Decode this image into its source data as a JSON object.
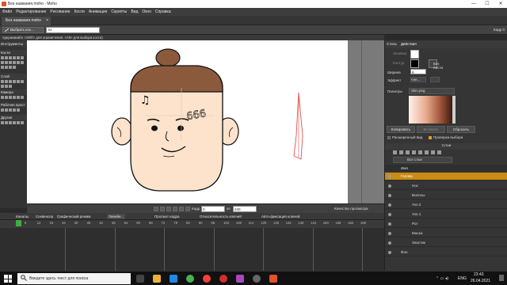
{
  "window": {
    "title": "Без названия.moho - Moho",
    "controls": [
      "—",
      "☐",
      "✕"
    ]
  },
  "menu": [
    "Файл",
    "Редактирование",
    "Рисование",
    "Кости",
    "Анимация",
    "Скрипты",
    "Вид",
    "Окно",
    "Справка"
  ],
  "doc_tab": {
    "label": "Без названия.moho",
    "close": "×"
  },
  "tool_options": {
    "mode_label": "Выбрать кос...",
    "name_value": "B1",
    "right_label": "Кадр 0"
  },
  "hint": "Удерживайте <Shift> для ограничения, <Alt> для выбора кости)",
  "left_panel": {
    "sections": [
      "Инструменты",
      "Кости",
      "Слой",
      "Камера",
      "Рабочее прост",
      "Другие"
    ]
  },
  "canvas": {
    "tattoo_text": "666",
    "note_symbol": "♫"
  },
  "transport": {
    "frame_label": "Кадр",
    "frame_value": "0",
    "of_label": "из",
    "end_value": "240",
    "quality_label": "Качество просмотра"
  },
  "timeline": {
    "tabs": [
      "Каналы",
      "Секвенсер",
      "Графический режим"
    ],
    "interp_value": "Линейн...",
    "bake_label": "Просмот кадра",
    "relative_label": "Относительность ключей",
    "autofix_label": "Авто-фиксация ключей",
    "ticks": [
      "6",
      "12",
      "18",
      "24",
      "30",
      "36",
      "42",
      "48",
      "54",
      "60",
      "66",
      "72",
      "78",
      "84",
      "90",
      "96",
      "102",
      "108",
      "114",
      "120",
      "126",
      "132",
      "138",
      "144",
      "150",
      "156",
      "162",
      "168"
    ]
  },
  "style_panel": {
    "tabs": [
      "Стиль",
      "Действия"
    ],
    "fill_label": "Заливка",
    "stroke_label": "Контур",
    "width_label": "Ширина",
    "width_value": "6",
    "effect_label": "Эффект",
    "effect_value": "<не...",
    "brush_label": "Без Кисти",
    "palette_label": "Палитры",
    "palette_value": "Skin.png",
    "copy_btn": "Копировать",
    "paste_btn": "Вставить",
    "reset_btn": "Сбросить",
    "advanced_label": "Расширенный вид",
    "check_sel_label": "Проверка выбора"
  },
  "layers_panel": {
    "header": "Слои",
    "all_layers": "Все слои",
    "name_col": "Имя",
    "layers": [
      {
        "name": "Голова",
        "indent": 0,
        "selected": true
      },
      {
        "name": "Нос",
        "indent": 1,
        "selected": false
      },
      {
        "name": "Волосы",
        "indent": 1,
        "selected": false
      },
      {
        "name": "Ухо 2",
        "indent": 1,
        "selected": false
      },
      {
        "name": "Ухо 1",
        "indent": 1,
        "selected": false
      },
      {
        "name": "Рот",
        "indent": 1,
        "selected": false
      },
      {
        "name": "Маска",
        "indent": 1,
        "selected": false
      },
      {
        "name": "Хвостик",
        "indent": 1,
        "selected": false
      },
      {
        "name": "Фон",
        "indent": 0,
        "selected": false
      }
    ]
  },
  "taskbar": {
    "search_placeholder": "Введите здесь текст для поиска",
    "lang": "ENG",
    "time": "23:43",
    "date": "26.04.2021",
    "apps": [
      "task-view",
      "file-explorer",
      "chrome",
      "yandex",
      "opera",
      "store",
      "obs",
      "moho"
    ]
  },
  "colors": {
    "accent": "#e0a020",
    "selection": "#c98b14",
    "guide": "#4a57c8",
    "skin": "#fde3cc",
    "hair": "#8b5a3c",
    "bone": "#e05050"
  }
}
